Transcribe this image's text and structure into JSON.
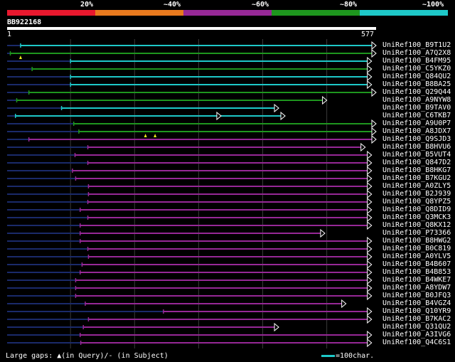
{
  "legend": {
    "ticks": [
      "20%",
      "~40%",
      "~60%",
      "~80%",
      "~100%"
    ],
    "colors": [
      "#e8182e",
      "#e87a1e",
      "#962896",
      "#1e961e",
      "#1ec8c8"
    ]
  },
  "query": {
    "id": "BB922168",
    "start_label": "1",
    "end_label": "577",
    "length": 577
  },
  "hits": [
    {
      "name": "UniRef100_B9T1U2",
      "start": 22,
      "end": 577,
      "color": "#1ec8c8",
      "ends": [
        577
      ]
    },
    {
      "name": "UniRef100_A7Q2X8",
      "start": 6,
      "end": 577,
      "color": "#1e961e",
      "ends": [
        577
      ],
      "marks": [
        22
      ]
    },
    {
      "name": "UniRef100_B4FM95",
      "start": 100,
      "end": 570,
      "color": "#1ec8c8",
      "ends": [
        570
      ]
    },
    {
      "name": "UniRef100_C5YKZ0",
      "start": 40,
      "end": 570,
      "color": "#1e961e",
      "ends": [
        570
      ]
    },
    {
      "name": "UniRef100_Q84QU2",
      "start": 100,
      "end": 570,
      "color": "#1ec8c8",
      "ends": [
        570
      ]
    },
    {
      "name": "UniRef100_B8BA25",
      "start": 100,
      "end": 570,
      "color": "#1ec8c8",
      "ends": [
        570
      ]
    },
    {
      "name": "UniRef100_Q29Q44",
      "start": 35,
      "end": 577,
      "color": "#1e961e",
      "ends": [
        577
      ]
    },
    {
      "name": "UniRef100_A9NYW8",
      "start": 16,
      "end": 500,
      "color": "#1e961e",
      "ends": [
        500
      ]
    },
    {
      "name": "UniRef100_B9TAV0",
      "start": 86,
      "end": 425,
      "color": "#1ec8c8",
      "ends": [
        425
      ]
    },
    {
      "name": "UniRef100_C6TKB7",
      "start": 14,
      "end": 435,
      "color": "#1ec8c8",
      "ends": [
        335,
        435
      ]
    },
    {
      "name": "UniRef100_A9U0P7",
      "start": 105,
      "end": 577,
      "color": "#1e961e",
      "ends": [
        577
      ]
    },
    {
      "name": "UniRef100_A8JDX7",
      "start": 113,
      "end": 577,
      "color": "#1e961e",
      "ends": [
        577
      ],
      "marks": [
        217,
        232
      ]
    },
    {
      "name": "UniRef100_Q9SJD3",
      "start": 35,
      "end": 577,
      "color": "#962896",
      "ends": [
        577
      ]
    },
    {
      "name": "UniRef100_B8HVU6",
      "start": 127,
      "end": 560,
      "color": "#962896",
      "ends": [
        560
      ]
    },
    {
      "name": "UniRef100_B5VUT4",
      "start": 107,
      "end": 570,
      "color": "#962896",
      "ends": [
        570
      ]
    },
    {
      "name": "UniRef100_Q847D2",
      "start": 127,
      "end": 570,
      "color": "#962896",
      "ends": [
        570
      ]
    },
    {
      "name": "UniRef100_B8HKG7",
      "start": 103,
      "end": 570,
      "color": "#962896",
      "ends": [
        570
      ]
    },
    {
      "name": "UniRef100_B7KGU2",
      "start": 108,
      "end": 570,
      "color": "#962896",
      "ends": [
        570
      ]
    },
    {
      "name": "UniRef100_A0ZLY5",
      "start": 128,
      "end": 570,
      "color": "#962896",
      "ends": [
        570
      ]
    },
    {
      "name": "UniRef100_B2J939",
      "start": 128,
      "end": 570,
      "color": "#962896",
      "ends": [
        570
      ]
    },
    {
      "name": "UniRef100_Q8YPZ5",
      "start": 127,
      "end": 570,
      "color": "#962896",
      "ends": [
        570
      ]
    },
    {
      "name": "UniRef100_Q8DID9",
      "start": 115,
      "end": 570,
      "color": "#962896",
      "ends": [
        570
      ]
    },
    {
      "name": "UniRef100_Q3MCK3",
      "start": 127,
      "end": 570,
      "color": "#962896",
      "ends": [
        570
      ]
    },
    {
      "name": "UniRef100_Q8KX12",
      "start": 115,
      "end": 570,
      "color": "#962896",
      "ends": [
        570
      ]
    },
    {
      "name": "UniRef100_P73366",
      "start": 115,
      "end": 497,
      "color": "#962896",
      "ends": [
        497
      ]
    },
    {
      "name": "UniRef100_B8HWG2",
      "start": 115,
      "end": 570,
      "color": "#962896",
      "ends": [
        570
      ]
    },
    {
      "name": "UniRef100_B0C819",
      "start": 127,
      "end": 570,
      "color": "#962896",
      "ends": [
        570
      ]
    },
    {
      "name": "UniRef100_A0YLV5",
      "start": 128,
      "end": 570,
      "color": "#962896",
      "ends": [
        570
      ]
    },
    {
      "name": "UniRef100_B4B607",
      "start": 118,
      "end": 570,
      "color": "#962896",
      "ends": [
        570
      ]
    },
    {
      "name": "UniRef100_B4B853",
      "start": 115,
      "end": 570,
      "color": "#962896",
      "ends": [
        570
      ]
    },
    {
      "name": "UniRef100_B4WKE7",
      "start": 108,
      "end": 570,
      "color": "#962896",
      "ends": [
        570
      ]
    },
    {
      "name": "UniRef100_A8YDW7",
      "start": 108,
      "end": 570,
      "color": "#962896",
      "ends": [
        570
      ]
    },
    {
      "name": "UniRef100_B0JFQ3",
      "start": 108,
      "end": 570,
      "color": "#962896",
      "ends": [
        570
      ]
    },
    {
      "name": "UniRef100_B4VGZ4",
      "start": 123,
      "end": 530,
      "color": "#962896",
      "ends": [
        530
      ]
    },
    {
      "name": "UniRef100_Q10YR9",
      "start": 245,
      "end": 570,
      "color": "#962896",
      "ends": [
        570
      ]
    },
    {
      "name": "UniRef100_B7KAC2",
      "start": 128,
      "end": 570,
      "color": "#962896",
      "ends": [
        570
      ]
    },
    {
      "name": "UniRef100_Q31QU2",
      "start": 120,
      "end": 425,
      "color": "#962896",
      "ends": [
        425
      ]
    },
    {
      "name": "UniRef100_A3IVG6",
      "start": 115,
      "end": 570,
      "color": "#962896",
      "ends": [
        570
      ]
    },
    {
      "name": "UniRef100_Q4C6S1",
      "start": 116,
      "end": 570,
      "color": "#962896",
      "ends": [
        570
      ]
    }
  ],
  "footer": {
    "gaps_label": "Large gaps: ▲(in Query)/- (in Subject)",
    "scale_label": "=100char.",
    "scale_color": "#1ec8c8"
  }
}
